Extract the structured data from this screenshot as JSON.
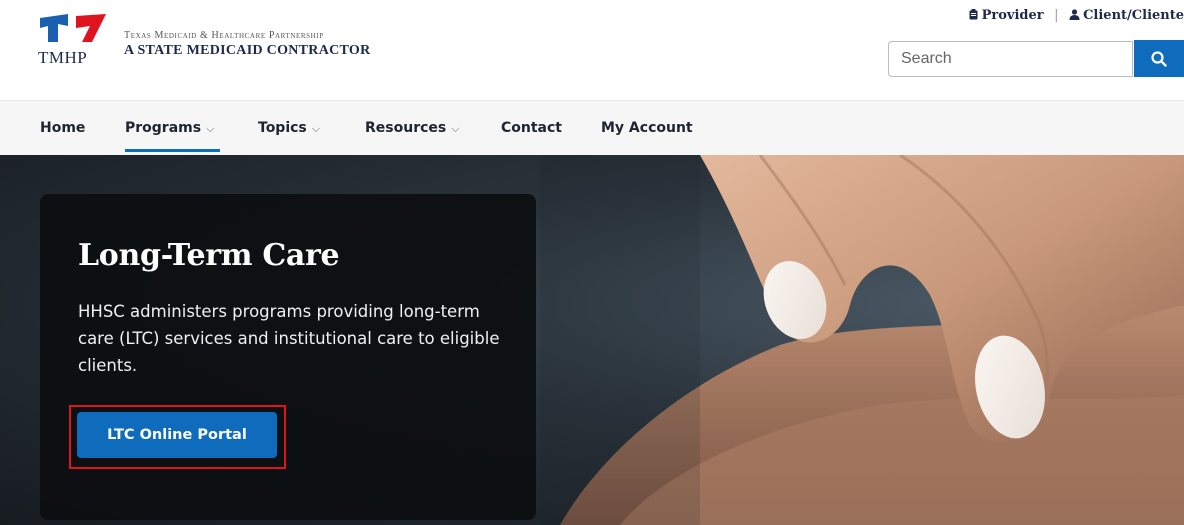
{
  "header": {
    "logo_acronym": "TMHP",
    "brand_line1": "Texas Medicaid & Healthcare Partnership",
    "brand_line2": "A STATE MEDICAID CONTRACTOR",
    "provider_link": "Provider",
    "client_link": "Client/Cliente",
    "search": {
      "placeholder": "Search"
    }
  },
  "nav": {
    "items": [
      {
        "label": "Home",
        "caret": ""
      },
      {
        "label": "Programs",
        "caret": "⌵"
      },
      {
        "label": "Topics",
        "caret": "⌵"
      },
      {
        "label": "Resources",
        "caret": "⌵"
      },
      {
        "label": "Contact",
        "caret": ""
      },
      {
        "label": "My Account",
        "caret": ""
      }
    ],
    "active": "Programs"
  },
  "hero": {
    "title": "Long-Term Care",
    "body": "HHSC administers programs providing long-term care (LTC) services and institutional care to eligible clients.",
    "cta_label": "LTC Online Portal"
  },
  "colors": {
    "primary_blue": "#0f6cbd",
    "highlight_red": "#e0141e",
    "logo_red": "#e0141e",
    "logo_blue": "#1b5fb0"
  }
}
